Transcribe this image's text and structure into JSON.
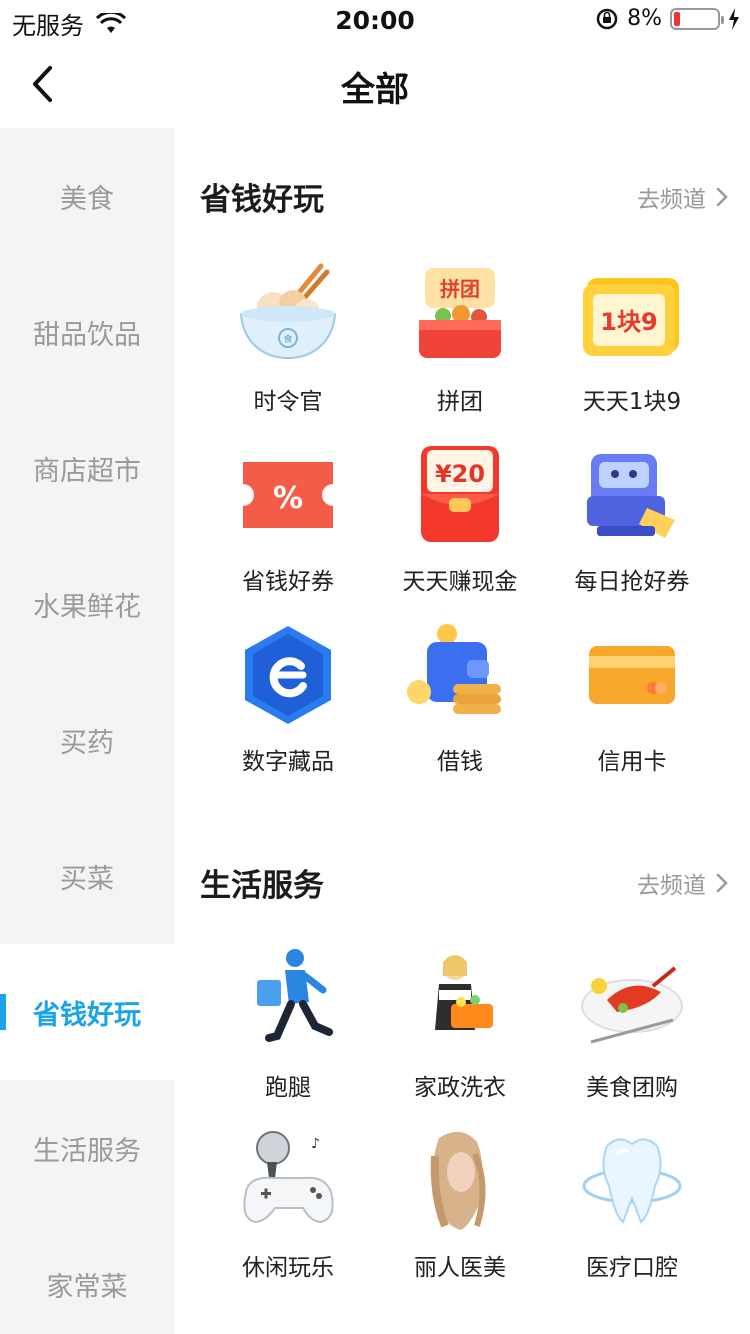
{
  "status_bar": {
    "carrier": "无服务",
    "time": "20:00",
    "battery": "8%"
  },
  "nav": {
    "title": "全部"
  },
  "sidebar": {
    "items": [
      {
        "label": "美食"
      },
      {
        "label": "甜品饮品"
      },
      {
        "label": "商店超市"
      },
      {
        "label": "水果鲜花"
      },
      {
        "label": "买药"
      },
      {
        "label": "买菜"
      },
      {
        "label": "省钱好玩"
      },
      {
        "label": "生活服务"
      },
      {
        "label": "家常菜"
      }
    ],
    "active": "省钱好玩"
  },
  "sections": [
    {
      "title": "省钱好玩",
      "link": "去频道",
      "items": [
        {
          "label": "时令官",
          "icon": "bowl-icon"
        },
        {
          "label": "拼团",
          "icon": "group-buy-icon",
          "badge": "拼团"
        },
        {
          "label": "天天1块9",
          "icon": "ticket-1-9-icon",
          "badge": "1块9"
        },
        {
          "label": "省钱好券",
          "icon": "coupon-icon",
          "badge": "%"
        },
        {
          "label": "天天赚现金",
          "icon": "red-envelope-icon",
          "badge": "¥20"
        },
        {
          "label": "每日抢好券",
          "icon": "coupon-machine-icon"
        },
        {
          "label": "数字藏品",
          "icon": "digital-collectible-icon"
        },
        {
          "label": "借钱",
          "icon": "wallet-coins-icon"
        },
        {
          "label": "信用卡",
          "icon": "credit-card-icon"
        }
      ]
    },
    {
      "title": "生活服务",
      "link": "去频道",
      "items": [
        {
          "label": "跑腿",
          "icon": "courier-icon"
        },
        {
          "label": "家政洗衣",
          "icon": "housekeeping-icon"
        },
        {
          "label": "美食团购",
          "icon": "lobster-dish-icon"
        },
        {
          "label": "休闲玩乐",
          "icon": "gamepad-icon"
        },
        {
          "label": "丽人医美",
          "icon": "beauty-icon"
        },
        {
          "label": "医疗口腔",
          "icon": "tooth-icon"
        }
      ]
    }
  ],
  "colors": {
    "accent": "#1aa3e8",
    "sidebar_bg": "#f4f4f4",
    "inactive_text": "#9a9a9a"
  }
}
